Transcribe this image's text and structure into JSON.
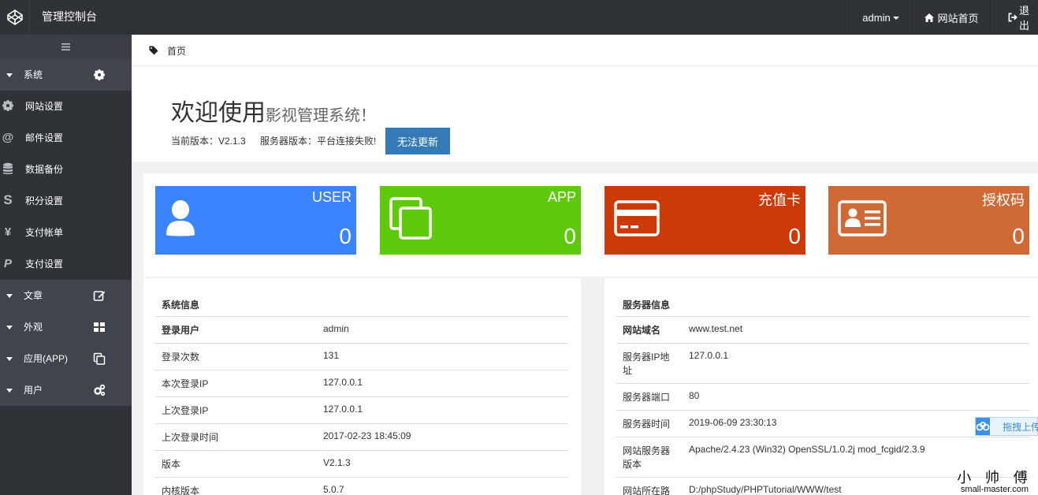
{
  "header": {
    "title": "管理控制台",
    "user": "admin",
    "home_link": "网站首页",
    "logout": "退出"
  },
  "sidebar": {
    "groups": [
      {
        "label": "系统",
        "icon": "gear-icon",
        "items": [
          {
            "label": "网站设置",
            "icon": "gear-icon"
          },
          {
            "label": "邮件设置",
            "icon": "at-icon"
          },
          {
            "label": "数据备份",
            "icon": "database-icon"
          },
          {
            "label": "积分设置",
            "icon": "dollar-icon"
          },
          {
            "label": "支付帐单",
            "icon": "yen-icon"
          },
          {
            "label": "支付设置",
            "icon": "paypal-icon"
          }
        ]
      },
      {
        "label": "文章",
        "icon": "edit-icon"
      },
      {
        "label": "外观",
        "icon": "grid-icon"
      },
      {
        "label": "应用(APP)",
        "icon": "copy-icon"
      },
      {
        "label": "用户",
        "icon": "cogs-icon"
      }
    ]
  },
  "breadcrumb": {
    "home": "首页"
  },
  "welcome": {
    "title": "欢迎使用",
    "subtitle": "影视管理系统！",
    "version_text": "当前版本：V2.1.3",
    "server_version_text": "服务器版本：平台连接失败!",
    "update_button": "无法更新"
  },
  "stats": [
    {
      "title": "USER",
      "value": "0",
      "color": "#3a84ff",
      "icon": "user-icon"
    },
    {
      "title": "APP",
      "value": "0",
      "color": "#5fc90b",
      "icon": "copy-icon"
    },
    {
      "title": "充值卡",
      "value": "0",
      "color": "#cc3a08",
      "icon": "credit-card-icon"
    },
    {
      "title": "授权码",
      "value": "0",
      "color": "#cf6a36",
      "icon": "id-card-icon"
    }
  ],
  "system_info": {
    "title": "系统信息",
    "rows": [
      {
        "k": "登录用户",
        "v": "admin"
      },
      {
        "k": "登录次数",
        "v": "131"
      },
      {
        "k": "本次登录IP",
        "v": "127.0.0.1"
      },
      {
        "k": "上次登录IP",
        "v": "127.0.0.1"
      },
      {
        "k": "上次登录时间",
        "v": "2017-02-23 18:45:09"
      },
      {
        "k": "版本",
        "v": "V2.1.3"
      },
      {
        "k": "内核版本",
        "v": "5.0.7"
      }
    ]
  },
  "server_info": {
    "title": "服务器信息",
    "rows": [
      {
        "k": "网站域名",
        "v": "www.test.net"
      },
      {
        "k": "服务器IP地址",
        "v": "127.0.0.1"
      },
      {
        "k": "服务器端口",
        "v": "80"
      },
      {
        "k": "服务器时间",
        "v": "2019-06-09 23:30:13"
      },
      {
        "k": "网站服务器版本",
        "v": "Apache/2.4.23 (Win32) OpenSSL/1.0.2j mod_fcgid/2.3.9"
      },
      {
        "k": "网站所在路",
        "v": "D:/phpStudy/PHPTutorial/WWW/test"
      }
    ]
  },
  "float_button": "拖拽上传",
  "watermark": {
    "line1": "小 帅 傅",
    "line2": "small-master.com"
  }
}
